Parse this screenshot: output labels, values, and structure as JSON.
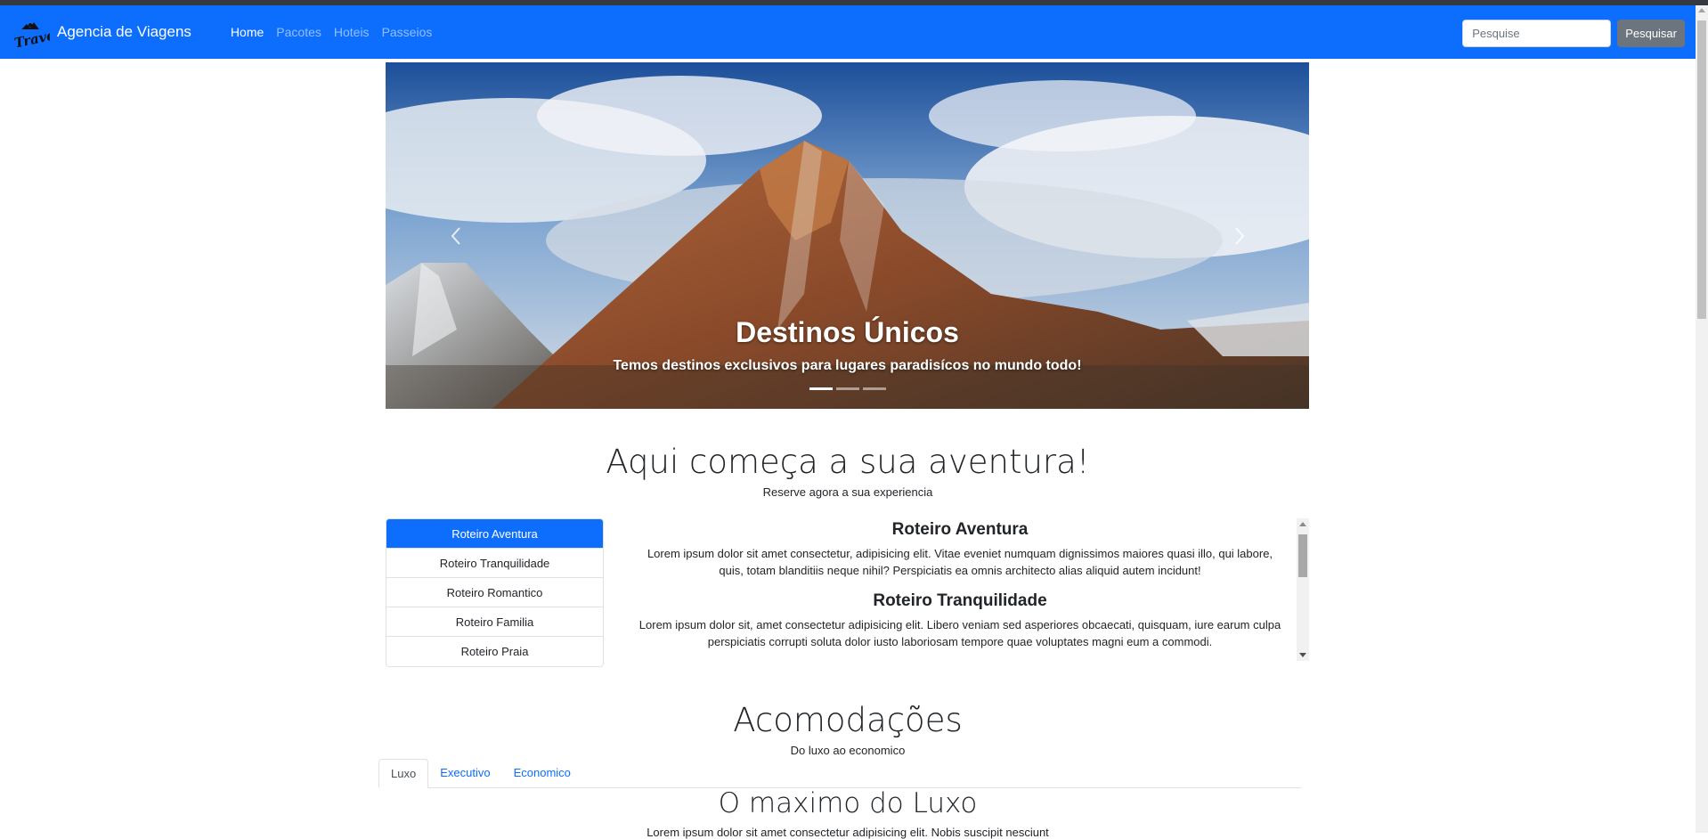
{
  "navbar": {
    "brand": "Agencia de Viagens",
    "logo_text": "Travel",
    "links": [
      {
        "label": "Home",
        "active": true
      },
      {
        "label": "Pacotes",
        "active": false
      },
      {
        "label": "Hoteis",
        "active": false
      },
      {
        "label": "Passeios",
        "active": false
      }
    ],
    "search": {
      "placeholder": "Pesquise",
      "button": "Pesquisar"
    },
    "background_color": "#0d6efd"
  },
  "carousel": {
    "caption_title": "Destinos Únicos",
    "caption_text": "Temos destinos exclusivos para lugares paradisícos no mundo todo!",
    "indicator_count": 3,
    "active_indicator": 0,
    "prev_icon": "chevron-left-icon",
    "next_icon": "chevron-right-icon"
  },
  "adventure": {
    "title": "Aqui começa a sua aventura!",
    "subtitle": "Reserve agora a sua experiencia",
    "list": [
      "Roteiro Aventura",
      "Roteiro Tranquilidade",
      "Roteiro Romantico",
      "Roteiro Familia",
      "Roteiro Praia"
    ],
    "sections": [
      {
        "heading": "Roteiro Aventura",
        "text": "Lorem ipsum dolor sit amet consectetur, adipisicing elit. Vitae eveniet numquam dignissimos maiores quasi illo, qui labore, quis, totam blanditiis neque nihil? Perspiciatis ea omnis architecto alias aliquid autem incidunt!"
      },
      {
        "heading": "Roteiro Tranquilidade",
        "text": "Lorem ipsum dolor sit, amet consectetur adipisicing elit. Libero veniam sed asperiores obcaecati, quisquam, iure earum culpa perspiciatis corrupti soluta dolor iusto laboriosam tempore quae voluptates magni eum a commodi."
      }
    ]
  },
  "accommodation": {
    "title": "Acomodações",
    "subtitle": "Do luxo ao economico",
    "tabs": [
      {
        "label": "Luxo",
        "active": true
      },
      {
        "label": "Executivo",
        "active": false
      },
      {
        "label": "Economico",
        "active": false
      }
    ],
    "content_title": "O maximo do Luxo",
    "content_text": "Lorem ipsum dolor sit amet consectetur adipisicing elit. Nobis suscipit nesciunt"
  },
  "colors": {
    "primary": "#0d6efd",
    "secondary": "#6c757d"
  }
}
